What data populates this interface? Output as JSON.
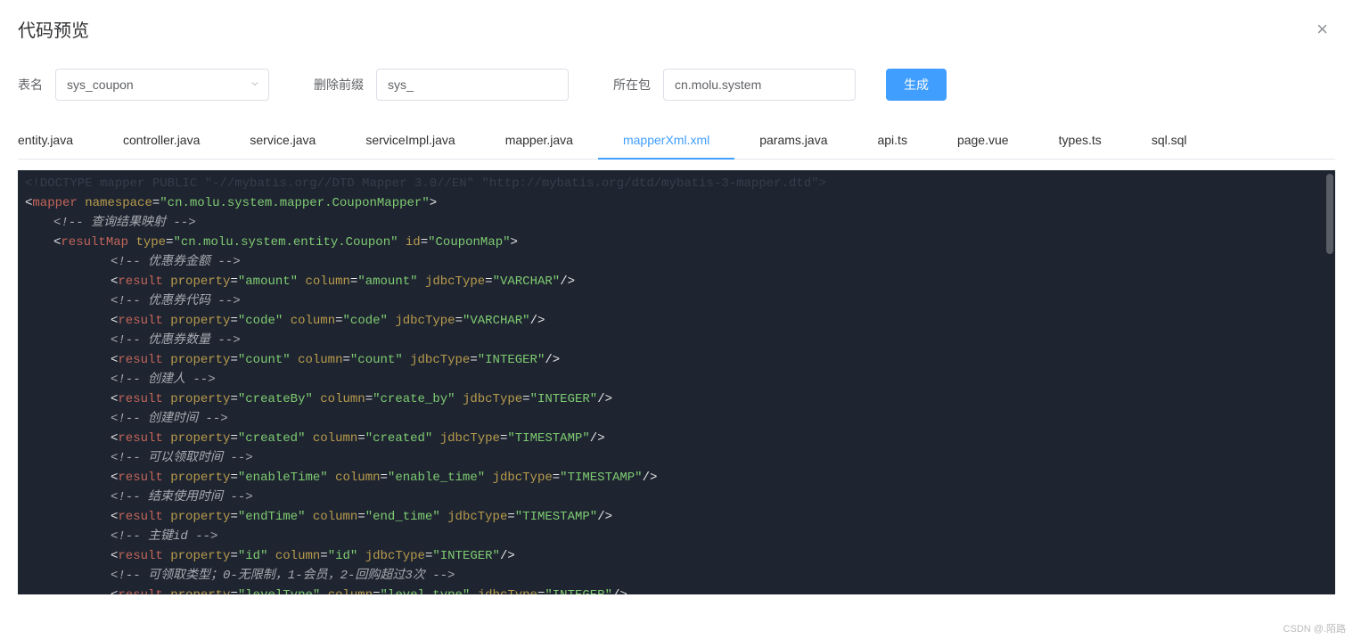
{
  "header": {
    "title": "代码预览"
  },
  "form": {
    "tableLabel": "表名",
    "tableValue": "sys_coupon",
    "prefixLabel": "删除前缀",
    "prefixValue": "sys_",
    "packageLabel": "所在包",
    "packageValue": "cn.molu.system",
    "generateLabel": "生成"
  },
  "tabs": [
    {
      "id": "entity",
      "label": "entity.java"
    },
    {
      "id": "controller",
      "label": "controller.java"
    },
    {
      "id": "service",
      "label": "service.java"
    },
    {
      "id": "serviceImpl",
      "label": "serviceImpl.java"
    },
    {
      "id": "mapper",
      "label": "mapper.java"
    },
    {
      "id": "mapperXml",
      "label": "mapperXml.xml",
      "active": true
    },
    {
      "id": "params",
      "label": "params.java"
    },
    {
      "id": "api",
      "label": "api.ts"
    },
    {
      "id": "page",
      "label": "page.vue"
    },
    {
      "id": "types",
      "label": "types.ts"
    },
    {
      "id": "sql",
      "label": "sql.sql"
    }
  ],
  "code": {
    "doctype": "<!DOCTYPE mapper PUBLIC \"-//mybatis.org//DTD Mapper 3.0//EN\" \"http://mybatis.org/dtd/mybatis-3-mapper.dtd\">",
    "mapperNamespace": "cn.molu.system.mapper.CouponMapper",
    "resultMapType": "cn.molu.system.entity.Coupon",
    "resultMapId": "CouponMap",
    "commentResultMap": "<!-- 查询结果映射 -->",
    "results": [
      {
        "comment": "<!-- 优惠券金额 -->",
        "property": "amount",
        "column": "amount",
        "jdbcType": "VARCHAR"
      },
      {
        "comment": "<!-- 优惠券代码 -->",
        "property": "code",
        "column": "code",
        "jdbcType": "VARCHAR"
      },
      {
        "comment": "<!-- 优惠券数量 -->",
        "property": "count",
        "column": "count",
        "jdbcType": "INTEGER"
      },
      {
        "comment": "<!-- 创建人 -->",
        "property": "createBy",
        "column": "create_by",
        "jdbcType": "INTEGER"
      },
      {
        "comment": "<!-- 创建时间 -->",
        "property": "created",
        "column": "created",
        "jdbcType": "TIMESTAMP"
      },
      {
        "comment": "<!-- 可以领取时间 -->",
        "property": "enableTime",
        "column": "enable_time",
        "jdbcType": "TIMESTAMP"
      },
      {
        "comment": "<!-- 结束使用时间 -->",
        "property": "endTime",
        "column": "end_time",
        "jdbcType": "TIMESTAMP"
      },
      {
        "comment": "<!-- 主键id -->",
        "property": "id",
        "column": "id",
        "jdbcType": "INTEGER"
      },
      {
        "comment": "<!-- 可领取类型；0-无限制，1-会员，2-回购超过3次 -->",
        "property": "levelType",
        "column": "level_type",
        "jdbcType": "INTEGER"
      }
    ]
  },
  "watermark": "CSDN @.陌路"
}
